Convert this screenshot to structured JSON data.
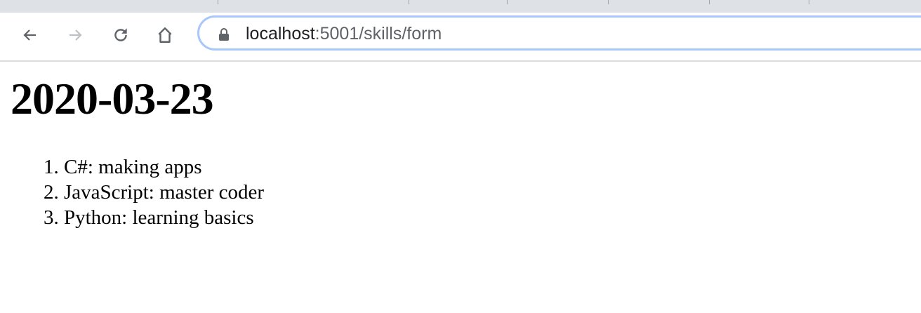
{
  "browser": {
    "url_host": "localhost",
    "url_path": ":5001/skills/form",
    "accent_color": "#a8c7fa"
  },
  "page": {
    "heading": "2020-03-23",
    "skills": [
      {
        "number": "1.",
        "text": "C#: making apps"
      },
      {
        "number": "2.",
        "text": "JavaScript: master coder"
      },
      {
        "number": "3.",
        "text": "Python: learning basics"
      }
    ]
  }
}
